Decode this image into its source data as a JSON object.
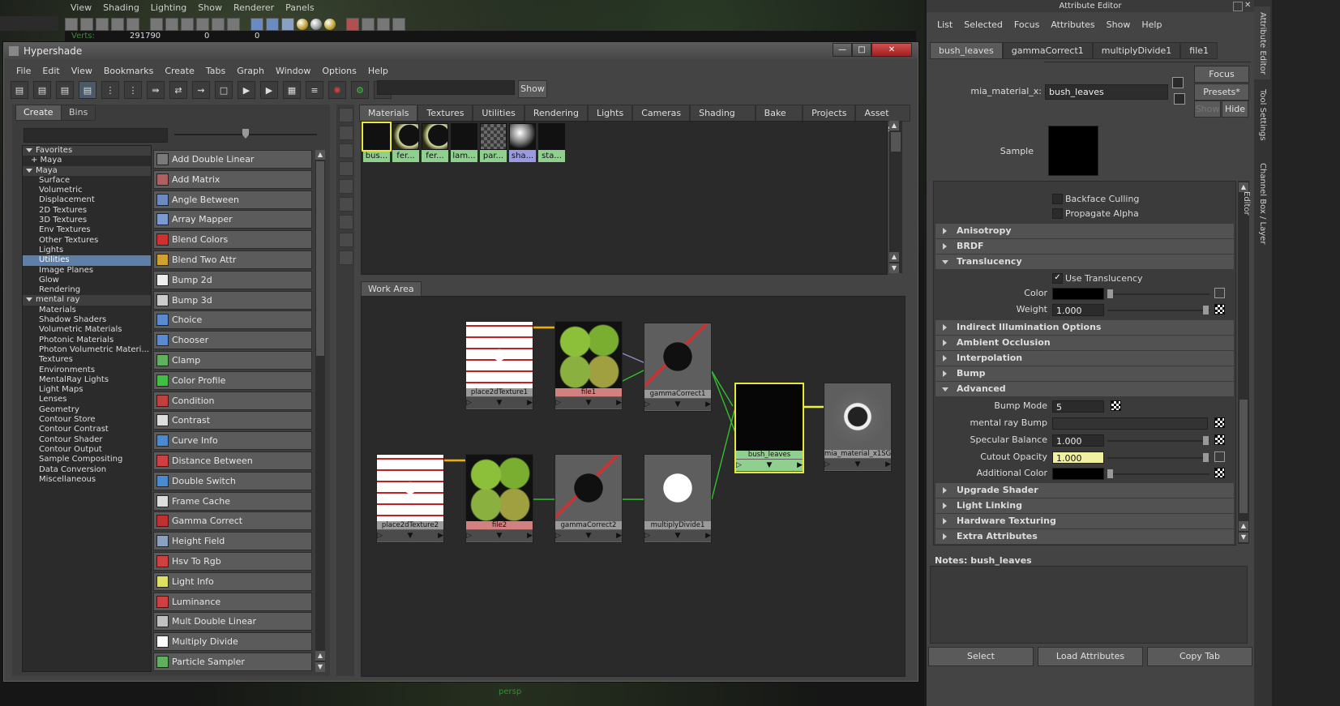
{
  "viewport": {
    "menu": [
      "View",
      "Shading",
      "Lighting",
      "Show",
      "Renderer",
      "Panels"
    ],
    "hud_verts_label": "Verts:",
    "hud_values": [
      "291790",
      "0",
      "0"
    ],
    "camera_label": "persp"
  },
  "hypershade": {
    "title": "Hypershade",
    "menu": [
      "File",
      "Edit",
      "View",
      "Bookmarks",
      "Create",
      "Tabs",
      "Graph",
      "Window",
      "Options",
      "Help"
    ],
    "search_show_button": "Show",
    "create_tabs": [
      "Create",
      "Bins"
    ],
    "tree": [
      {
        "label": "Favorites",
        "type": "grp"
      },
      {
        "label": "+ Maya",
        "type": "plus"
      },
      {
        "label": "Maya",
        "type": "grp"
      },
      {
        "label": "Surface",
        "type": "lv1"
      },
      {
        "label": "Volumetric",
        "type": "lv1"
      },
      {
        "label": "Displacement",
        "type": "lv1"
      },
      {
        "label": "2D Textures",
        "type": "lv1"
      },
      {
        "label": "3D Textures",
        "type": "lv1"
      },
      {
        "label": "Env Textures",
        "type": "lv1"
      },
      {
        "label": "Other Textures",
        "type": "lv1"
      },
      {
        "label": "Lights",
        "type": "lv1"
      },
      {
        "label": "Utilities",
        "type": "lv1",
        "selected": true
      },
      {
        "label": "Image Planes",
        "type": "lv1"
      },
      {
        "label": "Glow",
        "type": "lv1"
      },
      {
        "label": "Rendering",
        "type": "lv1"
      },
      {
        "label": "mental ray",
        "type": "grp"
      },
      {
        "label": "Materials",
        "type": "lv1"
      },
      {
        "label": "Shadow Shaders",
        "type": "lv1"
      },
      {
        "label": "Volumetric Materials",
        "type": "lv1"
      },
      {
        "label": "Photonic Materials",
        "type": "lv1"
      },
      {
        "label": "Photon Volumetric Materi...",
        "type": "lv1"
      },
      {
        "label": "Textures",
        "type": "lv1"
      },
      {
        "label": "Environments",
        "type": "lv1"
      },
      {
        "label": "MentalRay Lights",
        "type": "lv1"
      },
      {
        "label": "Light Maps",
        "type": "lv1"
      },
      {
        "label": "Lenses",
        "type": "lv1"
      },
      {
        "label": "Geometry",
        "type": "lv1"
      },
      {
        "label": "Contour Store",
        "type": "lv1"
      },
      {
        "label": "Contour Contrast",
        "type": "lv1"
      },
      {
        "label": "Contour Shader",
        "type": "lv1"
      },
      {
        "label": "Contour Output",
        "type": "lv1"
      },
      {
        "label": "Sample Compositing",
        "type": "lv1"
      },
      {
        "label": "Data Conversion",
        "type": "lv1"
      },
      {
        "label": "Miscellaneous",
        "type": "lv1"
      }
    ],
    "node_buttons": [
      {
        "label": "Add Double Linear",
        "icon": "#7a7a7a"
      },
      {
        "label": "Add Matrix",
        "icon": "#b06060"
      },
      {
        "label": "Angle Between",
        "icon": "#6a8ac0"
      },
      {
        "label": "Array Mapper",
        "icon": "#7a9ad0"
      },
      {
        "label": "Blend Colors",
        "icon": "#d03030"
      },
      {
        "label": "Blend Two Attr",
        "icon": "#d0a030"
      },
      {
        "label": "Bump 2d",
        "icon": "#eeeeee"
      },
      {
        "label": "Bump 3d",
        "icon": "#cccccc"
      },
      {
        "label": "Choice",
        "icon": "#5a8ad0"
      },
      {
        "label": "Chooser",
        "icon": "#5a8ad0"
      },
      {
        "label": "Clamp",
        "icon": "#60b060"
      },
      {
        "label": "Color Profile",
        "icon": "#40c040"
      },
      {
        "label": "Condition",
        "icon": "#c04040"
      },
      {
        "label": "Contrast",
        "icon": "#dddddd"
      },
      {
        "label": "Curve Info",
        "icon": "#4a8ad0"
      },
      {
        "label": "Distance Between",
        "icon": "#d04040"
      },
      {
        "label": "Double Switch",
        "icon": "#4a8ad0"
      },
      {
        "label": "Frame Cache",
        "icon": "#dddddd"
      },
      {
        "label": "Gamma Correct",
        "icon": "#c03030"
      },
      {
        "label": "Height Field",
        "icon": "#8aa0c0"
      },
      {
        "label": "Hsv To Rgb",
        "icon": "#d04040"
      },
      {
        "label": "Light Info",
        "icon": "#e0e060"
      },
      {
        "label": "Luminance",
        "icon": "#d04040"
      },
      {
        "label": "Mult Double Linear",
        "icon": "#c0c0c0"
      },
      {
        "label": "Multiply Divide",
        "icon": "#ffffff"
      },
      {
        "label": "Particle Sampler",
        "icon": "#60b060"
      }
    ],
    "top_tabs": [
      "Materials",
      "Textures",
      "Utilities",
      "Rendering",
      "Lights",
      "Cameras",
      "Shading Groups",
      "Bake Sets",
      "Projects",
      "Asset Nodes"
    ],
    "swatches": [
      {
        "label": "bus...",
        "color": "#8fd08f",
        "swatch": "black"
      },
      {
        "label": "fer...",
        "color": "#8fd08f",
        "swatch": "moon"
      },
      {
        "label": "fer...",
        "color": "#8fd08f",
        "swatch": "moon"
      },
      {
        "label": "lam...",
        "color": "#8fd08f",
        "swatch": "black"
      },
      {
        "label": "par...",
        "color": "#8fd08f",
        "swatch": "checker"
      },
      {
        "label": "sha...",
        "color": "#9a9ae0",
        "swatch": "sphere"
      },
      {
        "label": "sta...",
        "color": "#8fd08f",
        "swatch": "black"
      }
    ],
    "work_area_tab": "Work Area",
    "nodes": {
      "place2dTexture1": "place2dTexture1",
      "file1": "file1",
      "gammaCorrect1": "gammaCorrect1",
      "bush_leaves": "bush_leaves",
      "mia_material_x1SG": "mia_material_x1SG",
      "place2dTexture2": "place2dTexture2",
      "file2": "file2",
      "gammaCorrect2": "gammaCorrect2",
      "multiplyDivide1": "multiplyDivide1"
    },
    "colors": {
      "selected_node_border": "#e8e838",
      "material_label": "#8fd08f",
      "texture_label": "#d28080",
      "connection_green": "#30c030",
      "connection_yellow": "#f0b000"
    }
  },
  "attribute_editor": {
    "title": "Attribute Editor",
    "menu": [
      "List",
      "Selected",
      "Focus",
      "Attributes",
      "Show",
      "Help"
    ],
    "tabs": [
      "bush_leaves",
      "gammaCorrect1",
      "multiplyDivide1",
      "file1"
    ],
    "buttons": {
      "focus": "Focus",
      "presets": "Presets*",
      "show": "Show",
      "hide": "Hide"
    },
    "material_label": "mia_material_x:",
    "material_value": "bush_leaves",
    "sample_label": "Sample",
    "checkboxes_top": [
      {
        "label": "Backface Culling",
        "checked": false
      },
      {
        "label": "Propagate Alpha",
        "checked": false
      }
    ],
    "sections": {
      "anisotropy": "Anisotropy",
      "brdf": "BRDF",
      "translucency": "Translucency",
      "indirect": "Indirect Illumination Options",
      "ao": "Ambient Occlusion",
      "interp": "Interpolation",
      "bump": "Bump",
      "advanced": "Advanced",
      "upgrade": "Upgrade Shader",
      "linking": "Light Linking",
      "hwtex": "Hardware Texturing",
      "extra": "Extra Attributes"
    },
    "translucency": {
      "use_label": "Use Translucency",
      "use_checked": true,
      "color_label": "Color",
      "weight_label": "Weight",
      "weight_value": "1.000"
    },
    "advanced": {
      "bump_mode_label": "Bump Mode",
      "bump_mode_value": "5",
      "mr_bump_label": "mental ray Bump",
      "spec_label": "Specular Balance",
      "spec_value": "1.000",
      "cutout_label": "Cutout Opacity",
      "cutout_value": "1.000",
      "addcolor_label": "Additional Color"
    },
    "notes_label": "Notes:",
    "notes_value": "bush_leaves",
    "bottom_buttons": [
      "Select",
      "Load Attributes",
      "Copy Tab"
    ],
    "vertical_tabs": [
      "Attribute Editor",
      "Tool Settings",
      "Channel Box / Layer Editor"
    ]
  }
}
